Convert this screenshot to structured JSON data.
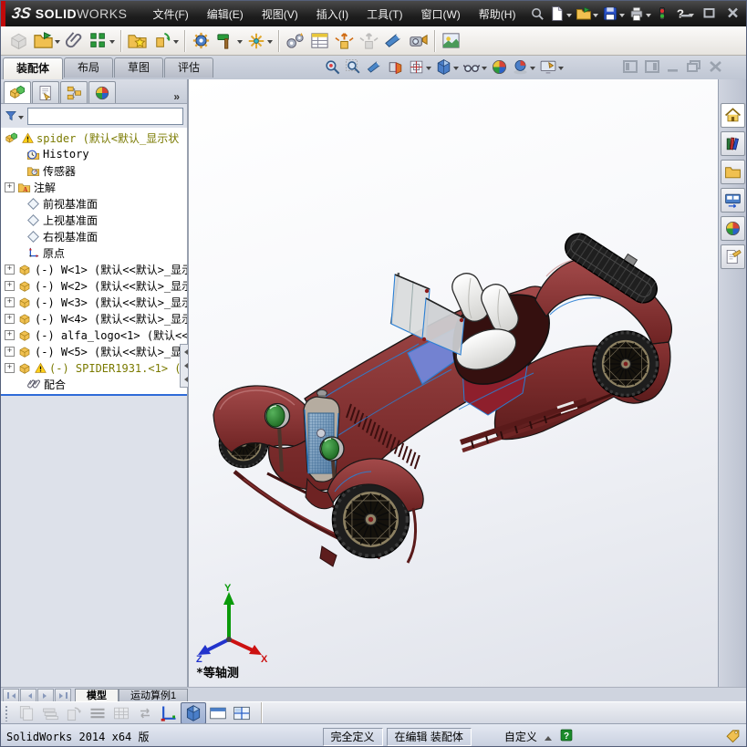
{
  "titlebar": {
    "logo_mark": "3S",
    "logo_solid": "SOLID",
    "logo_works": "WORKS"
  },
  "menubar": [
    "文件(F)",
    "编辑(E)",
    "视图(V)",
    "插入(I)",
    "工具(T)",
    "窗口(W)",
    "帮助(H)"
  ],
  "titlebar_icons": [
    "search",
    "new-document",
    "open",
    "save",
    "print",
    "options-traffic-light",
    "help"
  ],
  "window_buttons": [
    "minimize",
    "restore",
    "close"
  ],
  "main_toolbar_icons": [
    "insert-component",
    "open-part",
    "mate",
    "linear-component-pattern",
    "smart-fasteners",
    "move-component",
    "assembly-features",
    "assembly-tools",
    "reference-geometry",
    "new-motion-study",
    "bill-of-materials",
    "exploded-view",
    "explode-line-sketch",
    "interference-detection",
    "take-snapshot",
    "image-capture"
  ],
  "command_tabs": {
    "tabs": [
      "装配体",
      "布局",
      "草图",
      "评估"
    ],
    "active": "装配体"
  },
  "headsup_icons": [
    "zoom-to-fit",
    "zoom-to-area",
    "previous-view",
    "section-view",
    "view-orientation",
    "display-style",
    "hide-show-items",
    "edit-appearance",
    "apply-scene",
    "view-settings"
  ],
  "doc_window_controls": [
    "panel-toggle-left",
    "panel-toggle-right",
    "minimize-document",
    "restore-document",
    "close-document"
  ],
  "sidebar": {
    "panel_tabs": [
      "featuremanager-design-tree",
      "propertymanager",
      "configurationmanager",
      "displaymanager"
    ],
    "expand_chevron": "»",
    "expander_glyph": "+",
    "filter_value": "",
    "tree": [
      {
        "label": "spider (默认<默认_显示状",
        "icon": "assembly",
        "warning": true,
        "highlight": true
      },
      {
        "label": "History",
        "icon": "history"
      },
      {
        "label": "传感器",
        "icon": "sensors"
      },
      {
        "label": "注解",
        "icon": "annotations",
        "expander": true
      },
      {
        "label": "前视基准面",
        "icon": "plane"
      },
      {
        "label": "上视基准面",
        "icon": "plane"
      },
      {
        "label": "右视基准面",
        "icon": "plane"
      },
      {
        "label": "原点",
        "icon": "origin"
      },
      {
        "label": "(-) W<1> (默认<<默认>_显示",
        "icon": "component",
        "expander": true
      },
      {
        "label": "(-) W<2> (默认<<默认>_显示",
        "icon": "component",
        "expander": true
      },
      {
        "label": "(-) W<3> (默认<<默认>_显示",
        "icon": "component",
        "expander": true
      },
      {
        "label": "(-) W<4> (默认<<默认>_显示",
        "icon": "component",
        "expander": true
      },
      {
        "label": "(-) alfa_logo<1> (默认<<默",
        "icon": "component",
        "expander": true
      },
      {
        "label": "(-) W<5> (默认<<默认>_显示",
        "icon": "component",
        "expander": true
      },
      {
        "label": "(-) SPIDER1931.<1> (默认",
        "icon": "component",
        "warning": true,
        "highlight": true,
        "expander": true
      },
      {
        "label": "配合",
        "icon": "mates"
      }
    ]
  },
  "viewport": {
    "view_label": "*等轴测",
    "triad": {
      "x": "X",
      "y": "Y",
      "z": "Z"
    },
    "model_colors": {
      "body": "#8a3131",
      "edge_highlight": "#2a7fd4",
      "seats": "#f2f2ef",
      "grille": "#6d95bd",
      "headlights": "#2e8b2e",
      "cowl_panel": "#7285d8",
      "door_panel": "#8e1f2c"
    }
  },
  "task_pane_icons": [
    "solidworks-resources-home",
    "design-library",
    "file-explorer",
    "view-palette",
    "appearances-scenes",
    "custom-properties"
  ],
  "model_tabs": {
    "nav": [
      "first",
      "prev",
      "next",
      "last"
    ],
    "tabs": [
      "模型",
      "运动算例1"
    ],
    "active": "模型"
  },
  "bottom_toolbar_icons": [
    "sheet-pages",
    "layers",
    "rotate-sheet",
    "line-weights",
    "grid",
    "swap-views",
    "axes-display",
    "shaded-view",
    "single-viewport",
    "four-viewport"
  ],
  "status_bar": {
    "left": "SolidWorks 2014 x64 版",
    "define_state": "完全定义",
    "edit_state": "在编辑 装配体",
    "units": "自定义",
    "help_glyph": "?"
  }
}
